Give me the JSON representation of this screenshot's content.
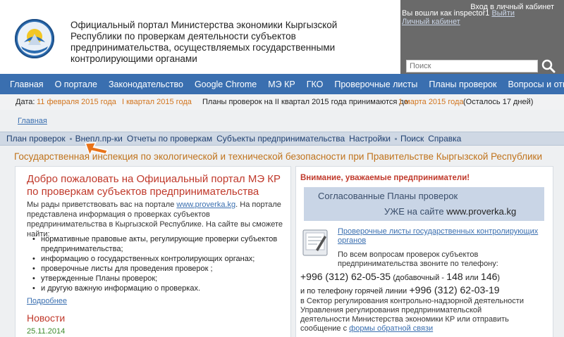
{
  "header": {
    "title": "Официальный портал Министерства экономики Кыргызской Республики по проверкам деятельности субъектов предпринимательства, осуществляемых государственными контролирующими органами",
    "cabinet_login": "Вход в личный кабинет",
    "logged_in_text": "Вы вошли как inspector1",
    "logout_label": "Выйти",
    "personal_cabinet_label": "Личный кабинет",
    "search_placeholder": "Поиск"
  },
  "main_nav": {
    "items": [
      "Главная",
      "О портале",
      "Законодательство",
      "Google Chrome",
      "МЭ КР",
      "ГКО",
      "Проверочные листы",
      "Планы проверок",
      "Вопросы и ответы"
    ]
  },
  "date_bar": {
    "date_label": "Дата:",
    "date_value": "11 февраля 2015 года",
    "quarter": "I квартал 2015 года",
    "plans_text": "Планы проверок на II квартал 2015 года принимаются до:",
    "deadline": "1 марта 2015 года",
    "remaining": "(Осталось 17 дней)"
  },
  "breadcrumb": "Главная",
  "sub_nav": {
    "items": [
      "План проверок",
      "Внепл.пр-ки",
      "Отчеты по проверкам",
      "Субъекты предпринимательства",
      "Настройки",
      "Поиск",
      "Справка"
    ]
  },
  "inspection_title": "Государственная инспекция по экологической и технической безопасности при Правительстве Кыргызской Республики",
  "left_panel": {
    "welcome_title": "Добро пожаловать на Официальный портал МЭ КР по проверкам субъектов предпринимательства",
    "intro_before": "Мы рады приветствовать вас на портале ",
    "intro_link": "www.proverka.kg",
    "intro_after": ". На портале представлена информация о проверках субъектов предпринимательства в Кыргызской Республике. На сайте вы сможете найти:",
    "features": [
      "нормативные правовые акты, регулирующие проверки субъектов предпринимательства;",
      "информацию о государственных контролирующих органах;",
      "проверочные листы для проведения проверок ;",
      "утвержденные Планы проверок;",
      "и другую важную информацию о проверках."
    ],
    "more_label": "Подробнее",
    "news_title": "Новости",
    "news_date": "25.11.2014"
  },
  "right_panel": {
    "attention": "Внимание, уважаемые предприниматели!",
    "banner_line1": "Согласованные Планы проверок",
    "banner_line2_prefix": "УЖЕ на сайте ",
    "banner_site": "www.proverka.kg",
    "checklists_link": "Проверочные листы государственных контролирующих органов",
    "questions_text": "По всем вопросам проверок субъектов предпринимательства звоните по телефону:",
    "phone_main": "+996 (312) 62-05-35",
    "phone_ext_prefix": "(добавочный -",
    "ext1": "148",
    "ext_or": "или",
    "ext2": "146",
    "ext_close": ")",
    "hotline_prefix": "и по телефону горячей линии",
    "hotline_number": "+996 (312) 62-03-19",
    "sector_text": "в Сектор регулирования контрольно-надзорной деятельности Управления регулирования предпринимательской деятельности Министерства экономики КР или отправить сообщение с ",
    "feedback_link": "формы обратной связи"
  },
  "colors": {
    "nav_blue": "#3a6fb0",
    "accent_orange": "#d2751e",
    "heading_red": "#c0392b",
    "news_green": "#3d8b2c"
  }
}
